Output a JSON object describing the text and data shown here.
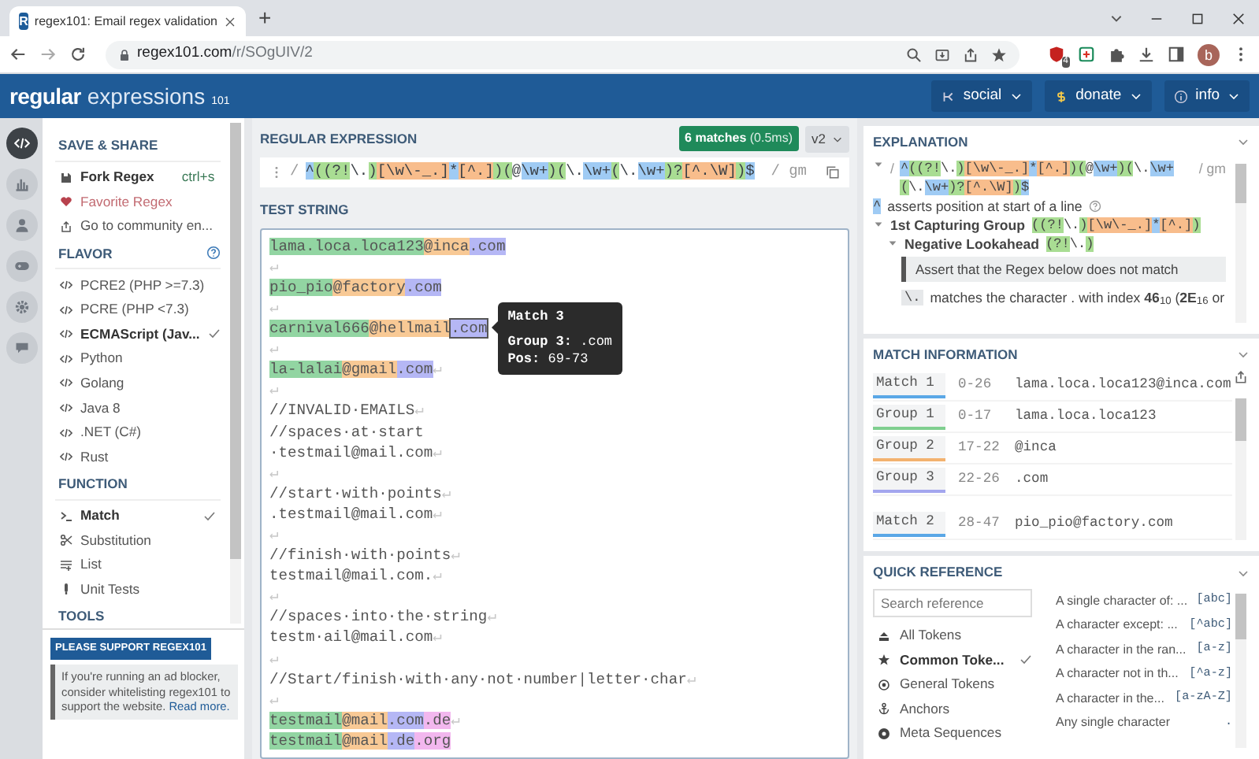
{
  "browser": {
    "tab_icon": "R",
    "tab_title": "regex101: Email regex validation",
    "new_tab": "+",
    "url_host": "regex101.com",
    "url_path": "/r/SOgUIV/2",
    "extension_badge": "4",
    "profile": "b"
  },
  "header": {
    "logo_main": "regular",
    "logo_second": "expressions",
    "logo_sub": "101",
    "menus": [
      {
        "kind": "social",
        "label": "social"
      },
      {
        "kind": "donate",
        "label": "donate"
      },
      {
        "kind": "info",
        "label": "info"
      }
    ]
  },
  "rail": [
    {
      "kind": "code",
      "selected": true
    },
    {
      "kind": "chart",
      "selected": false
    },
    {
      "kind": "user",
      "selected": false
    },
    {
      "kind": "game",
      "selected": false
    },
    {
      "kind": "gear",
      "selected": false
    },
    {
      "kind": "chat",
      "selected": false
    }
  ],
  "sidebar": {
    "sections": [
      {
        "title": "SAVE & SHARE",
        "items": [
          {
            "kind": "save",
            "label": "Fork Regex",
            "shortcut": "ctrl+s"
          },
          {
            "kind": "heart",
            "label": "Favorite Regex"
          },
          {
            "kind": "share",
            "label": "Go to community en..."
          }
        ]
      },
      {
        "title": "FLAVOR",
        "help": true,
        "items": [
          {
            "kind": "code",
            "label": "PCRE2 (PHP >=7.3)",
            "selected": false
          },
          {
            "kind": "code",
            "label": "PCRE (PHP <7.3)",
            "selected": false
          },
          {
            "kind": "code",
            "label": "ECMAScript (Jav...",
            "selected": true
          },
          {
            "kind": "code",
            "label": "Python",
            "selected": false
          },
          {
            "kind": "code",
            "label": "Golang",
            "selected": false
          },
          {
            "kind": "code",
            "label": "Java 8",
            "selected": false
          },
          {
            "kind": "code",
            "label": ".NET (C#)",
            "selected": false
          },
          {
            "kind": "code",
            "label": "Rust",
            "selected": false
          }
        ]
      },
      {
        "title": "FUNCTION",
        "items": [
          {
            "kind": "terminal",
            "label": "Match",
            "selected": true
          },
          {
            "kind": "scissors",
            "label": "Substitution",
            "selected": false
          },
          {
            "kind": "list",
            "label": "List",
            "selected": false
          },
          {
            "kind": "tube",
            "label": "Unit Tests",
            "selected": false
          }
        ]
      },
      {
        "title": "TOOLS"
      }
    ]
  },
  "ad": {
    "title": "PLEASE SUPPORT REGEX101",
    "text": "If you're running an ad blocker, consider whitelisting regex101 to support the website.",
    "link": "Read more."
  },
  "regex_panel": {
    "title": "REGULAR EXPRESSION",
    "matches": "6 matches",
    "timing": "(0.5ms)",
    "version": "v2",
    "delimiter": "/",
    "flags": "/ gm",
    "segments": [
      {
        "text": "^",
        "kind": "anchor"
      },
      {
        "text": "((?!",
        "kind": "group"
      },
      {
        "text": "\\.",
        "kind": "plain"
      },
      {
        "text": ")",
        "kind": "group"
      },
      {
        "text": "[\\w\\-_.]",
        "kind": "class"
      },
      {
        "text": "*",
        "kind": "quant"
      },
      {
        "text": "[^.]",
        "kind": "class"
      },
      {
        "text": ")",
        "kind": "group"
      },
      {
        "text": "(",
        "kind": "group"
      },
      {
        "text": "@",
        "kind": "plain"
      },
      {
        "text": "\\w+",
        "kind": "quant"
      },
      {
        "text": ")",
        "kind": "group"
      },
      {
        "text": "(",
        "kind": "group"
      },
      {
        "text": "\\.",
        "kind": "plain"
      },
      {
        "text": "\\w+",
        "kind": "quant"
      },
      {
        "text": "(",
        "kind": "group"
      },
      {
        "text": "\\.",
        "kind": "plain"
      },
      {
        "text": "\\w+",
        "kind": "quant"
      },
      {
        "text": ")?",
        "kind": "group"
      },
      {
        "text": "[^.\\W]",
        "kind": "class"
      },
      {
        "text": ")",
        "kind": "group"
      },
      {
        "text": "$",
        "kind": "anchor"
      }
    ]
  },
  "test_string": {
    "title": "TEST STRING",
    "lines": [
      [
        {
          "text": "lama.loca.loca123",
          "kind": "g1"
        },
        {
          "text": "@inca",
          "kind": "g2"
        },
        {
          "text": ".com",
          "kind": "g3"
        }
      ],
      [
        {
          "text": "↵",
          "kind": "ws"
        }
      ],
      [
        {
          "text": "pio_pio",
          "kind": "g1"
        },
        {
          "text": "@factory",
          "kind": "g2"
        },
        {
          "text": ".com",
          "kind": "g3"
        }
      ],
      [
        {
          "text": "↵",
          "kind": "ws"
        }
      ],
      [
        {
          "text": "carnival666",
          "kind": "g1"
        },
        {
          "text": "@hellmail",
          "kind": "g2"
        },
        {
          "text": ".com",
          "kind": "g3",
          "hovered": true
        }
      ],
      [
        {
          "text": "↵",
          "kind": "ws"
        }
      ],
      [
        {
          "text": "la-lalai",
          "kind": "g1"
        },
        {
          "text": "@gmail",
          "kind": "g2"
        },
        {
          "text": ".com",
          "kind": "g3"
        },
        {
          "text": "↵",
          "kind": "ws"
        }
      ],
      [
        {
          "text": "↵",
          "kind": "ws"
        }
      ],
      [
        {
          "text": "//INVALID·EMAILS",
          "kind": "plain"
        },
        {
          "text": "↵",
          "kind": "ws"
        }
      ],
      [
        {
          "text": "//spaces·at·start",
          "kind": "plain"
        }
      ],
      [
        {
          "text": "·testmail@mail.com",
          "kind": "plain"
        },
        {
          "text": "↵",
          "kind": "ws"
        }
      ],
      [
        {
          "text": "↵",
          "kind": "ws"
        }
      ],
      [
        {
          "text": "//start·with·points",
          "kind": "plain"
        },
        {
          "text": "↵",
          "kind": "ws"
        }
      ],
      [
        {
          "text": ".testmail@mail.com",
          "kind": "plain"
        },
        {
          "text": "↵",
          "kind": "ws"
        }
      ],
      [
        {
          "text": "↵",
          "kind": "ws"
        }
      ],
      [
        {
          "text": "//finish·with·points",
          "kind": "plain"
        },
        {
          "text": "↵",
          "kind": "ws"
        }
      ],
      [
        {
          "text": "testmail@mail.com.",
          "kind": "plain"
        },
        {
          "text": "↵",
          "kind": "ws"
        }
      ],
      [
        {
          "text": "↵",
          "kind": "ws"
        }
      ],
      [
        {
          "text": "//spaces·into·the·string",
          "kind": "plain"
        },
        {
          "text": "↵",
          "kind": "ws"
        }
      ],
      [
        {
          "text": "testm·ail@mail.com",
          "kind": "plain"
        },
        {
          "text": "↵",
          "kind": "ws"
        }
      ],
      [
        {
          "text": "↵",
          "kind": "ws"
        }
      ],
      [
        {
          "text": "//Start/finish·with·any·not·number|letter·char",
          "kind": "plain"
        },
        {
          "text": "↵",
          "kind": "ws"
        }
      ],
      [
        {
          "text": "↵",
          "kind": "ws"
        }
      ],
      [
        {
          "text": "testmail",
          "kind": "g1"
        },
        {
          "text": "@mail",
          "kind": "g2"
        },
        {
          "text": ".com",
          "kind": "g3"
        },
        {
          "text": ".de",
          "kind": "g4"
        },
        {
          "text": "↵",
          "kind": "ws"
        }
      ],
      [
        {
          "text": "testmail",
          "kind": "g1"
        },
        {
          "text": "@mail",
          "kind": "g2"
        },
        {
          "text": ".de",
          "kind": "g3"
        },
        {
          "text": ".org",
          "kind": "g4"
        }
      ]
    ],
    "tooltip": {
      "title": "Match 3",
      "rows": [
        {
          "label": "Group 3:",
          "value": ".com"
        },
        {
          "label": "Pos:",
          "value": "69-73"
        }
      ]
    }
  },
  "explanation": {
    "title": "EXPLANATION",
    "flags": "/ gm",
    "delimiter": "/",
    "regex": [
      {
        "text": "^",
        "kind": "anchor"
      },
      {
        "text": "((?!",
        "kind": "group"
      },
      {
        "text": "\\.",
        "kind": "plain"
      },
      {
        "text": ")",
        "kind": "group"
      },
      {
        "text": "[\\w\\-_.]",
        "kind": "class"
      },
      {
        "text": "*",
        "kind": "quant"
      },
      {
        "text": "[^.]",
        "kind": "class"
      },
      {
        "text": ")",
        "kind": "group"
      },
      {
        "text": "(",
        "kind": "group"
      },
      {
        "text": "@",
        "kind": "plain"
      },
      {
        "text": "\\w+",
        "kind": "quant"
      },
      {
        "text": ")",
        "kind": "group"
      },
      {
        "text": "(",
        "kind": "group"
      },
      {
        "text": "\\.",
        "kind": "plain"
      },
      {
        "text": "\\w+",
        "kind": "quant"
      },
      {
        "text": "(",
        "kind": "group"
      },
      {
        "text": "\\.",
        "kind": "plain"
      },
      {
        "text": "\\w+",
        "kind": "quant"
      },
      {
        "text": ")?",
        "kind": "group"
      },
      {
        "text": "[^.\\W]",
        "kind": "class"
      },
      {
        "text": ")",
        "kind": "group"
      },
      {
        "text": "$",
        "kind": "anchor"
      }
    ],
    "rows": [
      {
        "kind": "token",
        "token": [
          {
            "text": "^",
            "kind": "anchor"
          }
        ],
        "text": "asserts position at start of a line"
      },
      {
        "kind": "node",
        "label": "1st Capturing Group",
        "expanded": true,
        "token": [
          {
            "text": "((?!",
            "kind": "group"
          },
          {
            "text": "\\.",
            "kind": "plain"
          },
          {
            "text": ")",
            "kind": "group"
          },
          {
            "text": "[\\w\\-_.]",
            "kind": "class"
          },
          {
            "text": "*",
            "kind": "quant"
          },
          {
            "text": "[^.]",
            "kind": "class"
          },
          {
            "text": ")",
            "kind": "group"
          }
        ],
        "children": [
          {
            "kind": "node",
            "label": "Negative Lookahead",
            "expanded": true,
            "token": [
              {
                "text": "(?!",
                "kind": "group"
              },
              {
                "text": "\\.",
                "kind": "plain"
              },
              {
                "text": ")",
                "kind": "group"
              }
            ],
            "children": [
              {
                "kind": "note",
                "text": "Assert that the Regex below does not match"
              },
              {
                "kind": "token",
                "token": [
                  {
                    "text": "\\.",
                    "kind": "code"
                  }
                ],
                "text": "matches the character . with index **46**$_{10}$ (**2E**$_{16}$ or"
              }
            ]
          }
        ]
      }
    ]
  },
  "match_info": {
    "title": "MATCH INFORMATION",
    "rows": [
      {
        "label": "Match 1",
        "range": "0-26",
        "value": "lama.loca.loca123@inca.com",
        "color": "#5aa7e6"
      },
      {
        "label": "Group 1",
        "range": "0-17",
        "value": "lama.loca.loca123",
        "color": "#7fcf8f"
      },
      {
        "label": "Group 2",
        "range": "17-22",
        "value": "@inca",
        "color": "#f3b26f"
      },
      {
        "label": "Group 3",
        "range": "22-26",
        "value": ".com",
        "color": "#a3a6ee"
      },
      {
        "label": "Match 2",
        "range": "28-47",
        "value": "pio_pio@factory.com",
        "color": "#5aa7e6"
      }
    ]
  },
  "quick_reference": {
    "title": "QUICK REFERENCE",
    "placeholder": "Search reference",
    "categories": [
      {
        "kind": "all",
        "label": "All Tokens",
        "selected": false
      },
      {
        "kind": "star",
        "label": "Common Toke...",
        "selected": true
      },
      {
        "kind": "target",
        "label": "General Tokens",
        "selected": false
      },
      {
        "kind": "anchor",
        "label": "Anchors",
        "selected": false
      },
      {
        "kind": "meta",
        "label": "Meta Sequences",
        "selected": false
      }
    ],
    "tokens": [
      {
        "desc": "A single character of: ...",
        "token": "[abc]"
      },
      {
        "desc": "A character except: ...",
        "token": "[^abc]"
      },
      {
        "desc": "A character in the ran...",
        "token": "[a-z]"
      },
      {
        "desc": "A character not in th...",
        "token": "[^a-z]"
      },
      {
        "desc": "A character in the...",
        "token": "[a-zA-Z]"
      },
      {
        "desc": "Any single character",
        "token": "."
      }
    ]
  }
}
